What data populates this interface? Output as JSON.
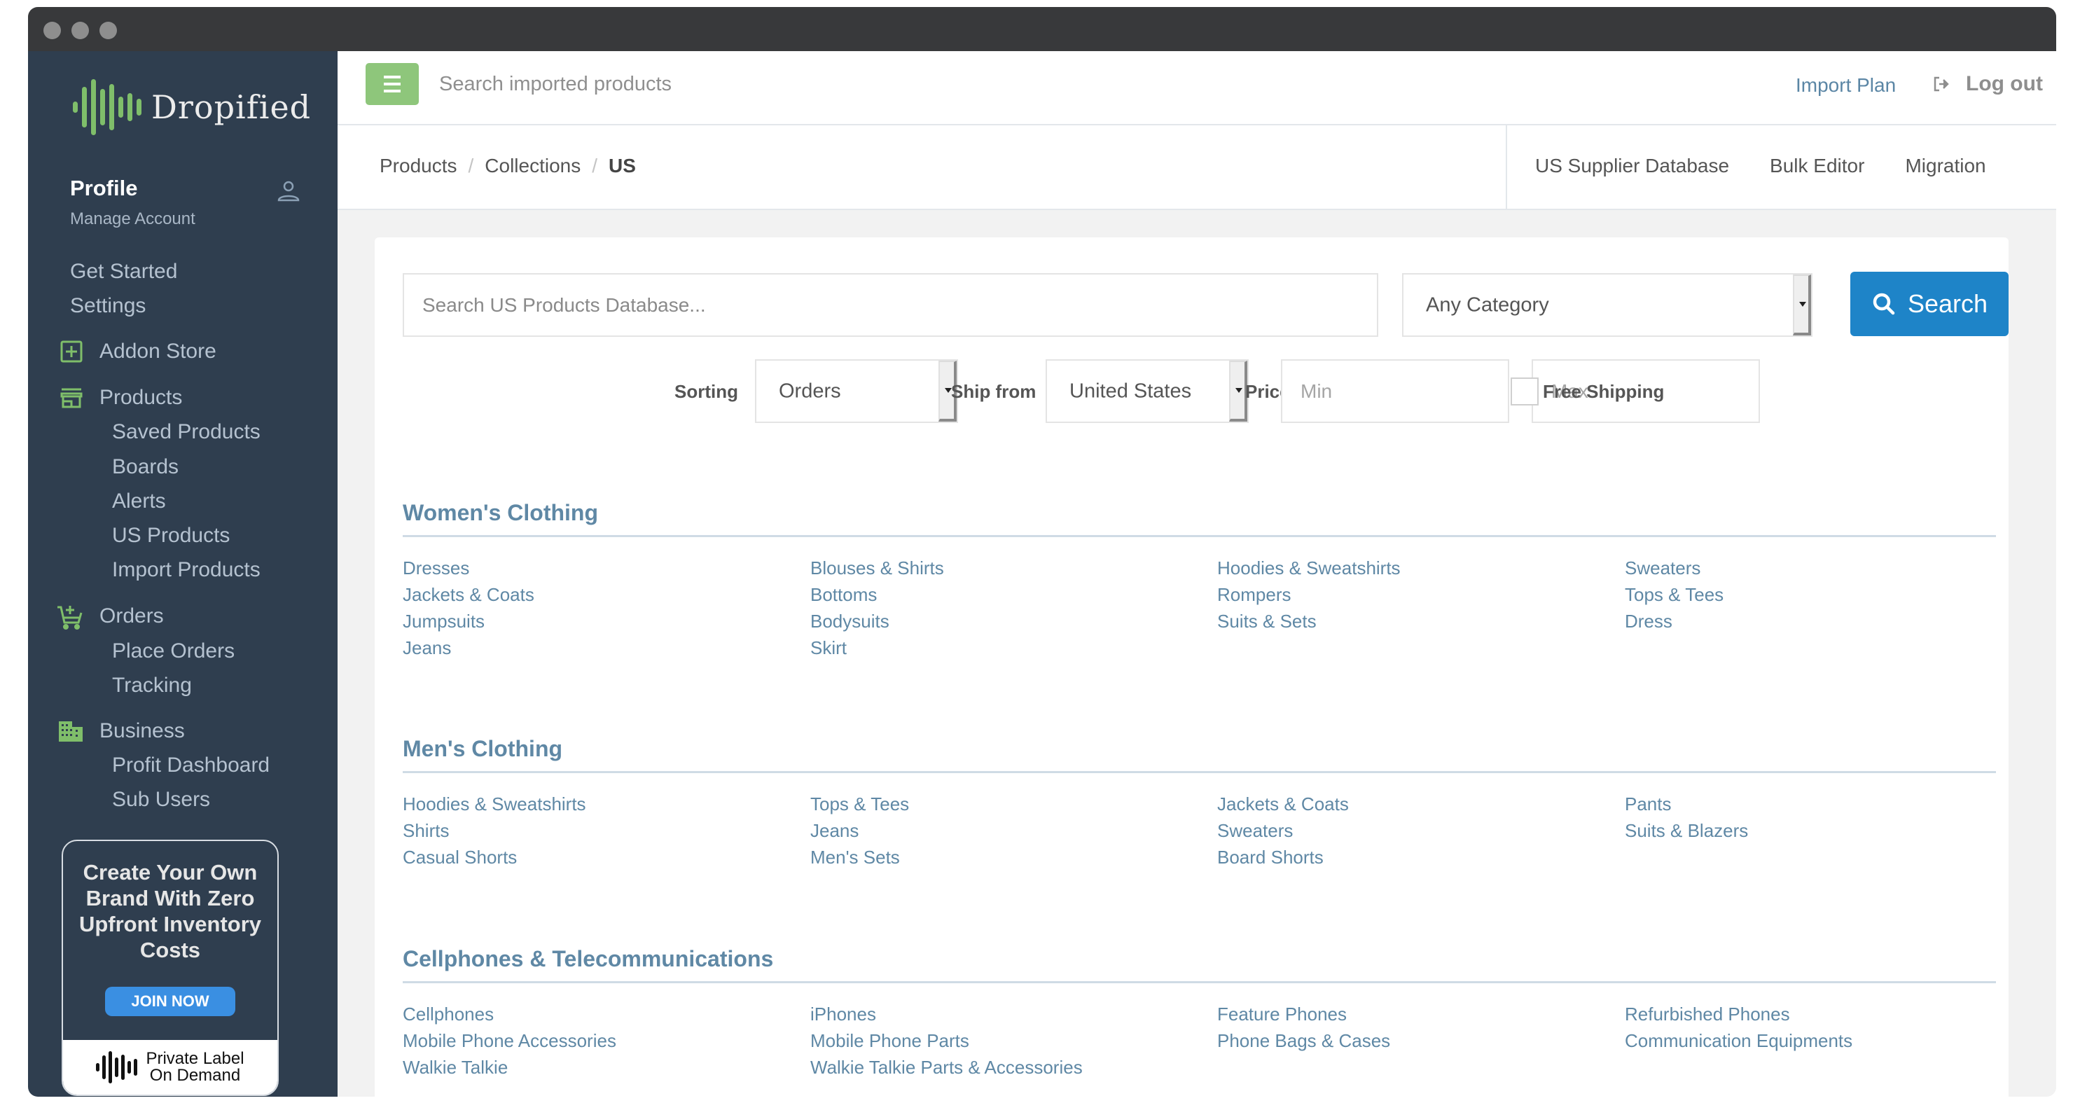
{
  "window": {
    "controls": [
      "close",
      "minimize",
      "maximize"
    ]
  },
  "sidebar": {
    "logo_text": "Dropified",
    "profile": {
      "name": "Profile",
      "subtitle": "Manage Account",
      "icon": "user-icon"
    },
    "items": [
      {
        "label": "Get Started",
        "level": 0
      },
      {
        "label": "Settings",
        "level": 0
      },
      {
        "label": "Addon Store",
        "level": 0,
        "icon": "plus-square-icon"
      },
      {
        "label": "Products",
        "level": 0,
        "icon": "store-icon"
      },
      {
        "label": "Saved Products",
        "level": 1
      },
      {
        "label": "Boards",
        "level": 1
      },
      {
        "label": "Alerts",
        "level": 1
      },
      {
        "label": "US Products",
        "level": 1
      },
      {
        "label": "Import Products",
        "level": 1
      },
      {
        "label": "Orders",
        "level": 0,
        "icon": "cart-plus-icon"
      },
      {
        "label": "Place Orders",
        "level": 1
      },
      {
        "label": "Tracking",
        "level": 1
      },
      {
        "label": "Business",
        "level": 0,
        "icon": "building-icon"
      },
      {
        "label": "Profit Dashboard",
        "level": 1
      },
      {
        "label": "Sub Users",
        "level": 1
      }
    ],
    "promo": {
      "title": "Create Your Own Brand With Zero Upfront Inventory Costs",
      "button": "JOIN NOW",
      "footer_line1": "Private Label",
      "footer_line2": "On Demand"
    }
  },
  "topbar": {
    "menu_icon": "hamburger-icon",
    "search_placeholder": "Search imported products",
    "import_plan": "Import Plan",
    "logout": "Log out",
    "logout_icon": "sign-out-icon"
  },
  "breadcrumb": {
    "items": [
      "Products",
      "Collections",
      "US"
    ],
    "separator": "/",
    "links": [
      "US Supplier Database",
      "Bulk Editor",
      "Migration"
    ]
  },
  "search": {
    "placeholder": "Search US Products Database...",
    "category": "Any Category",
    "button": "Search",
    "button_color": "#1e84c8"
  },
  "filters": {
    "sorting_label": "Sorting",
    "sorting_value": "Orders",
    "ship_from_label": "Ship from",
    "ship_from_value": "United States",
    "price_label": "Price",
    "price_min_placeholder": "Min",
    "price_max_placeholder": "Max",
    "free_shipping_label": "Free Shipping",
    "free_shipping_checked": false
  },
  "sections": [
    {
      "title": "Women's Clothing",
      "columns": [
        [
          "Dresses",
          "Jackets & Coats",
          "Jumpsuits",
          "Jeans"
        ],
        [
          "Blouses & Shirts",
          "Bottoms",
          "Bodysuits",
          "Skirt"
        ],
        [
          "Hoodies & Sweatshirts",
          "Rompers",
          "Suits & Sets"
        ],
        [
          "Sweaters",
          "Tops & Tees",
          "Dress"
        ]
      ]
    },
    {
      "title": "Men's Clothing",
      "columns": [
        [
          "Hoodies & Sweatshirts",
          "Shirts",
          "Casual Shorts"
        ],
        [
          "Tops & Tees",
          "Jeans",
          "Men's Sets"
        ],
        [
          "Jackets & Coats",
          "Sweaters",
          "Board Shorts"
        ],
        [
          "Pants",
          "Suits & Blazers"
        ]
      ]
    },
    {
      "title": "Cellphones & Telecommunications",
      "columns": [
        [
          "Cellphones",
          "Mobile Phone Accessories",
          "Walkie Talkie"
        ],
        [
          "iPhones",
          "Mobile Phone Parts",
          "Walkie Talkie Parts & Accessories"
        ],
        [
          "Feature Phones",
          "Phone Bags & Cases"
        ],
        [
          "Refurbished Phones",
          "Communication Equipments"
        ]
      ]
    }
  ]
}
